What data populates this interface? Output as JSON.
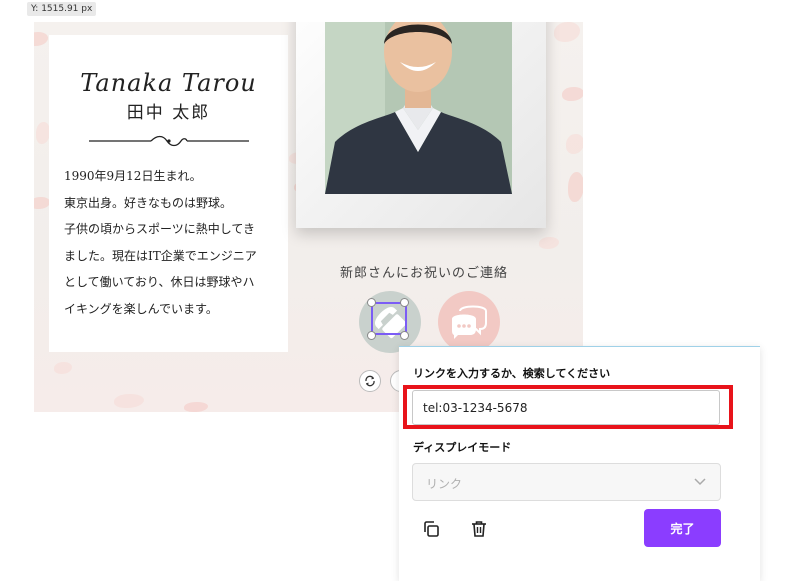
{
  "position_readout": "Y: 1515.91 px",
  "card": {
    "name_en": "Tanaka Tarou",
    "name_ja": "田中 太郎",
    "bio_lines": [
      "1990年9月12日生まれ。",
      "東京出身。好きなものは野球。",
      "子供の頃からスポーツに熱中してき",
      "ました。現在はIT企業でエンジニア",
      "として働いており、休日は野球やハ",
      "イキングを楽しんでいます。"
    ]
  },
  "contact_section": {
    "title": "新郎さんにお祝いのご連絡",
    "icons": [
      "phone-icon",
      "chat-bubble-icon"
    ]
  },
  "link_panel": {
    "link_label": "リンクを入力するか、検索してください",
    "link_value": "tel:03-1234-5678",
    "display_mode_label": "ディスプレイモード",
    "display_mode_selected": "リンク",
    "done_label": "完了",
    "accent_color": "#8b3dff",
    "highlight_color": "#e8131a"
  }
}
